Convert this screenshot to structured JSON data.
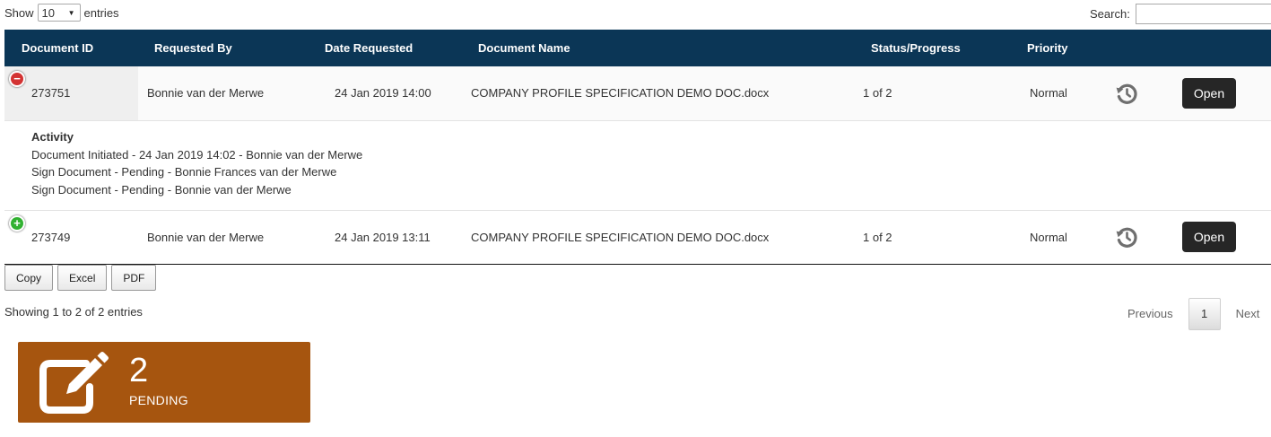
{
  "length": {
    "prefix": "Show",
    "selected": "10",
    "suffix": "entries"
  },
  "search": {
    "label": "Search:",
    "value": ""
  },
  "table": {
    "columns": [
      "Document ID",
      "Requested By",
      "Date Requested",
      "Document Name",
      "Status/Progress",
      "Priority"
    ],
    "rows": [
      {
        "id": "273751",
        "requested_by": "Bonnie van der Merwe",
        "date": "24 Jan 2019 14:00",
        "document": "COMPANY PROFILE SPECIFICATION DEMO DOC.docx",
        "status": "1 of 2",
        "priority": "Normal",
        "open_label": "Open",
        "toggle": "−",
        "activity": {
          "title": "Activity",
          "lines": [
            "Document Initiated - 24 Jan 2019 14:02 - Bonnie van der Merwe",
            "Sign Document - Pending - Bonnie Frances van der Merwe",
            "Sign Document - Pending - Bonnie van der Merwe"
          ]
        }
      },
      {
        "id": "273749",
        "requested_by": "Bonnie van der Merwe",
        "date": "24 Jan 2019 13:11",
        "document": "COMPANY PROFILE SPECIFICATION DEMO DOC.docx",
        "status": "1 of 2",
        "priority": "Normal",
        "open_label": "Open",
        "toggle": "+"
      }
    ]
  },
  "export_buttons": [
    "Copy",
    "Excel",
    "PDF"
  ],
  "info": "Showing 1 to 2 of 2 entries",
  "pagination": {
    "previous": "Previous",
    "current": "1",
    "next": "Next"
  },
  "stat_tile": {
    "count": "2",
    "label": "PENDING",
    "color": "#a6550f",
    "icon": "edit-icon"
  },
  "colors": {
    "header": "#0b3656",
    "open_button": "#262626",
    "expand": "#31b131",
    "collapse": "#d33333"
  }
}
